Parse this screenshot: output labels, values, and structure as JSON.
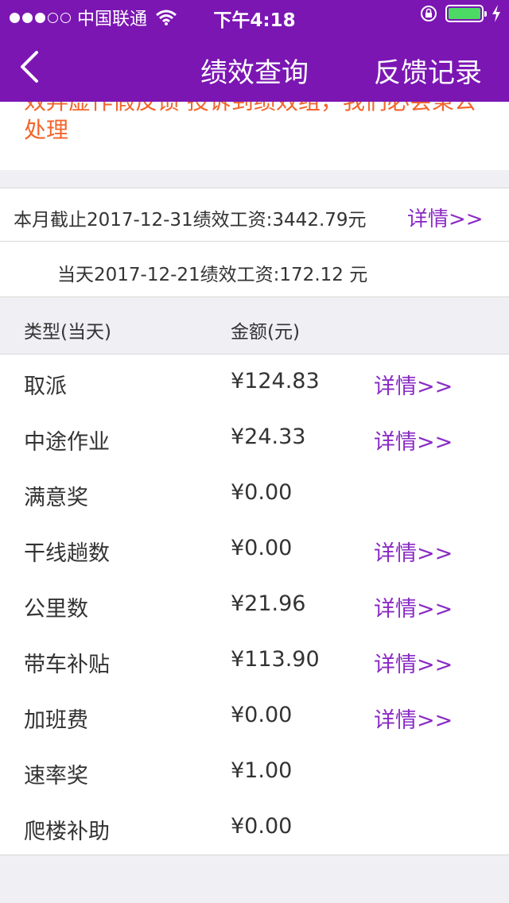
{
  "status_bar": {
    "carrier": "中国联通",
    "time": "下午4:18",
    "signal_bars_filled": 3,
    "signal_bars_total": 5,
    "battery_level": 1.0
  },
  "nav": {
    "title": "绩效查询",
    "right_label": "反馈记录",
    "back_icon": "chevron-left-icon"
  },
  "notice": {
    "text": "效弄虚作假反馈  投诉到绩效组，我们必会秉公处理"
  },
  "month_summary": {
    "label": "本月截止2017-12-31绩效工资:3442.79元",
    "link": "详情>>"
  },
  "today_summary": {
    "label": "当天2017-12-21绩效工资:172.12 元"
  },
  "table": {
    "headers": [
      "类型(当天)",
      "金额(元)"
    ],
    "rows": [
      {
        "type": "取派",
        "amount": "¥124.83",
        "link": "详情>>"
      },
      {
        "type": "中途作业",
        "amount": "¥24.33",
        "link": "详情>>"
      },
      {
        "type": "满意奖",
        "amount": "¥0.00",
        "link": ""
      },
      {
        "type": "干线趟数",
        "amount": "¥0.00",
        "link": "详情>>"
      },
      {
        "type": "公里数",
        "amount": "¥21.96",
        "link": "详情>>"
      },
      {
        "type": "带车补贴",
        "amount": "¥113.90",
        "link": "详情>>"
      },
      {
        "type": "加班费",
        "amount": "¥0.00",
        "link": "详情>>"
      },
      {
        "type": "速率奖",
        "amount": "¥1.00",
        "link": ""
      },
      {
        "type": "爬楼补助",
        "amount": "¥0.00",
        "link": ""
      }
    ]
  },
  "colors": {
    "brand": "#7b16b3",
    "link": "#8a2bc4",
    "notice": "#f2652b",
    "battery": "#4cd964"
  }
}
